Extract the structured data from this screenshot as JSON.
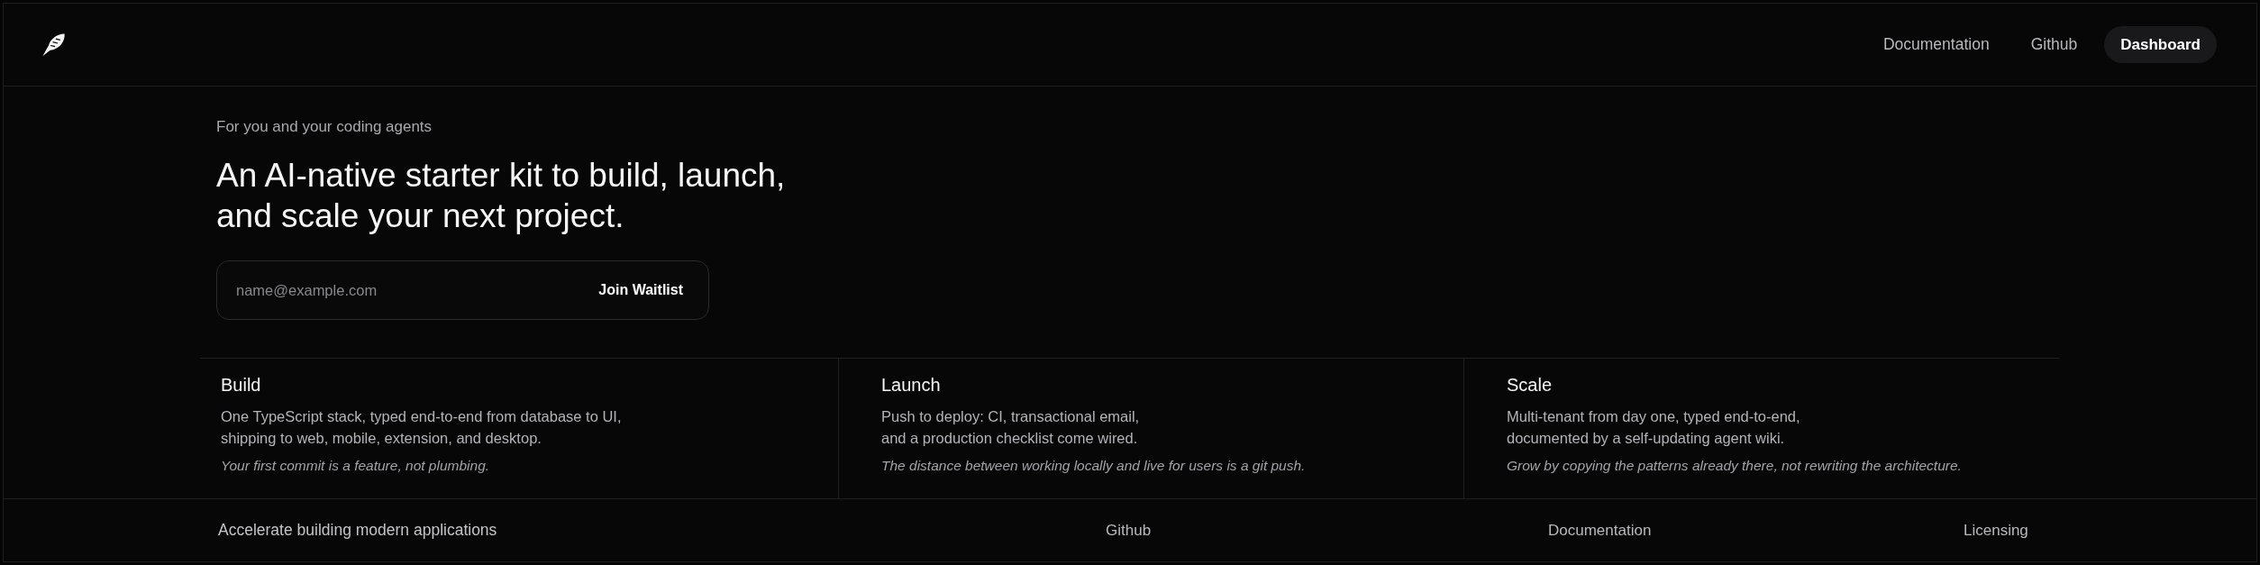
{
  "header": {
    "nav": [
      {
        "label": "Documentation",
        "kind": "link"
      },
      {
        "label": "Github",
        "kind": "link"
      },
      {
        "label": "Dashboard",
        "kind": "button"
      }
    ]
  },
  "hero": {
    "eyebrow": "For you and your coding agents",
    "headline_lines": [
      "An AI-native starter kit to build, launch,",
      "and scale your next project."
    ],
    "signup": {
      "placeholder": "name@example.com",
      "button": "Join Waitlist"
    }
  },
  "features": [
    {
      "title": "Build",
      "lines": [
        "One TypeScript stack, typed end-to-end from database to UI,",
        "shipping to web, mobile, extension, and desktop."
      ],
      "tagline": "Your first commit is a feature, not plumbing."
    },
    {
      "title": "Launch",
      "lines": [
        "Push to deploy: CI, transactional email,",
        "and a production checklist come wired."
      ],
      "tagline": "The distance between working locally and live for users is a git push."
    },
    {
      "title": "Scale",
      "lines": [
        "Multi-tenant from day one, typed end-to-end,",
        "documented by a self-updating agent wiki."
      ],
      "tagline": "Grow by copying the patterns already there, not rewriting the architecture."
    }
  ],
  "footer": {
    "tagline": "Accelerate building modern applications",
    "links": [
      "Github",
      "Documentation",
      "Licensing"
    ]
  }
}
